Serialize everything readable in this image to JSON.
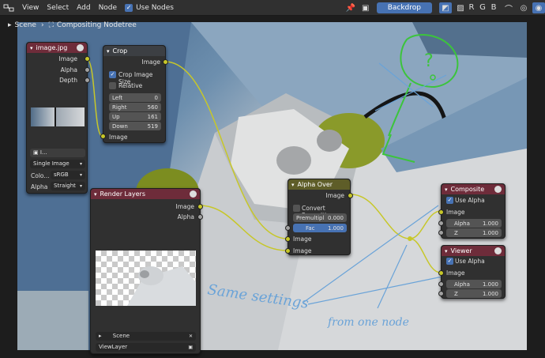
{
  "header": {
    "menus": [
      "View",
      "Select",
      "Add",
      "Node"
    ],
    "use_nodes_label": "Use Nodes",
    "backdrop_label": "Backdrop",
    "channels": [
      "R",
      "G",
      "B"
    ]
  },
  "breadcrumb": {
    "scene": "Scene",
    "tree": "Compositing Nodetree"
  },
  "image_node": {
    "title": "image.jpg",
    "outputs": [
      "Image",
      "Alpha",
      "Depth"
    ],
    "image_field": "I...",
    "source": "Single Image",
    "color_label": "Colo...",
    "color_value": "sRGB",
    "alpha_label": "Alpha",
    "alpha_value": "Straight"
  },
  "crop_node": {
    "title": "Crop",
    "output": "Image",
    "crop_size_label": "Crop Image Size",
    "relative_label": "Relative",
    "fields": [
      {
        "label": "Left",
        "value": "0"
      },
      {
        "label": "Right",
        "value": "560"
      },
      {
        "label": "Up",
        "value": "161"
      },
      {
        "label": "Down",
        "value": "519"
      }
    ],
    "input": "Image"
  },
  "render_node": {
    "title": "Render Layers",
    "outputs": [
      "Image",
      "Alpha"
    ],
    "scene": "Scene",
    "layer": "ViewLayer"
  },
  "alpha_over_node": {
    "title": "Alpha Over",
    "output": "Image",
    "convert_label": "Convert Premulti...",
    "premul_label": "Premultipl",
    "premul_value": "0.000",
    "fac_label": "Fac",
    "fac_value": "1.000",
    "inputs": [
      "Image",
      "Image"
    ]
  },
  "composite_node": {
    "title": "Composite",
    "use_alpha_label": "Use Alpha",
    "image_label": "Image",
    "alpha_label": "Alpha",
    "alpha_value": "1.000",
    "z_label": "Z",
    "z_value": "1.000"
  },
  "viewer_node": {
    "title": "Viewer",
    "use_alpha_label": "Use Alpha",
    "image_label": "Image",
    "alpha_label": "Alpha",
    "alpha_value": "1.000",
    "z_label": "Z",
    "z_value": "1.000"
  },
  "annotations": {
    "question": "?",
    "same_settings": "Same settings",
    "from_one_node": "from one node"
  },
  "colors": {
    "accent": "#4772b3",
    "image_socket": "#c7c729",
    "value_socket": "#a1a1a1",
    "annotation_blue": "#6aa3d8",
    "annotation_green": "#3cc43c"
  }
}
